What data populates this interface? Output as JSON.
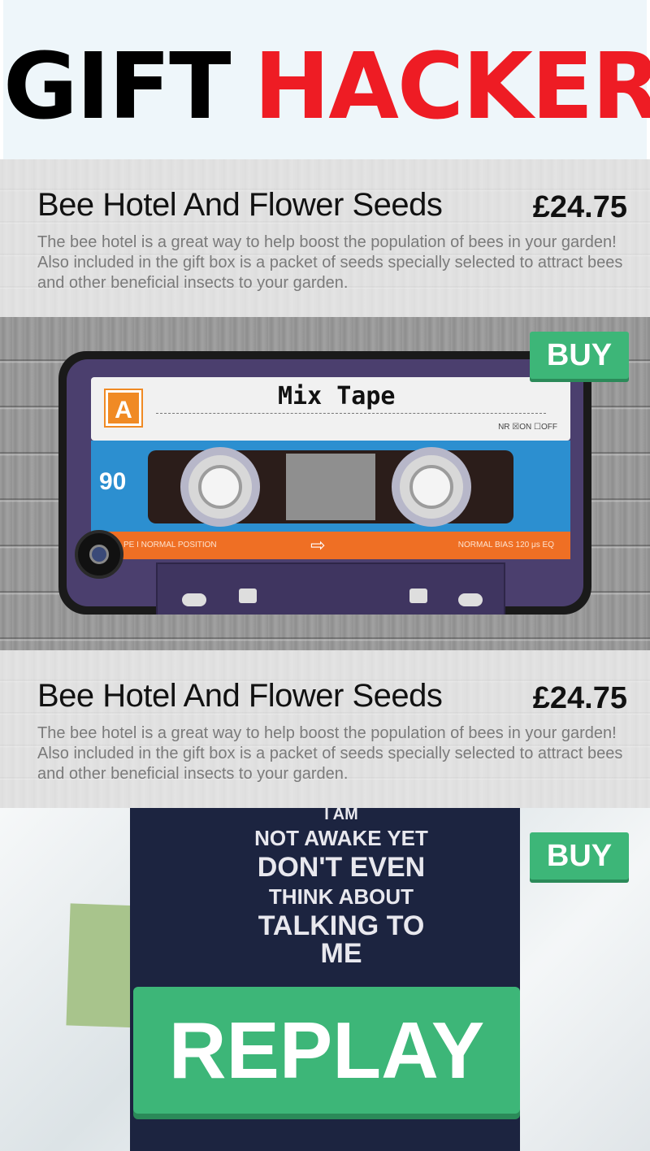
{
  "logo": {
    "word1": "GIFT",
    "word2": "HACKER",
    "color1": "#000000",
    "color2": "#ee1c24"
  },
  "products": [
    {
      "title": "Bee Hotel And Flower Seeds",
      "price": "£24.75",
      "description": "The bee hotel is a great way to help boost the population of bees in your garden! Also included in the gift box is a packet of seeds specially selected to attract bees and other beneficial insects to your garden.",
      "buy_label": "BUY",
      "image": {
        "badge": "A",
        "label": "Mix Tape",
        "length": "90",
        "switch_text": "NR ☒ON ☐OFF",
        "band_left": "PE I NORMAL POSITION",
        "band_right": "NORMAL BIAS 120 μs EQ"
      }
    },
    {
      "title": "Bee Hotel And Flower Seeds",
      "price": "£24.75",
      "description": "The bee hotel is a great way to help boost the population of bees in your garden! Also included in the gift box is a packet of seeds specially selected to attract bees and other beneficial insects to your garden.",
      "buy_label": "BUY",
      "image": {
        "shirt_lines": [
          "I AM",
          "NOT AWAKE YET",
          "DON'T EVEN",
          "THINK ABOUT",
          "TALKING TO ME"
        ]
      }
    }
  ],
  "replay_label": "REPLAY",
  "accent_color": "#3db678"
}
